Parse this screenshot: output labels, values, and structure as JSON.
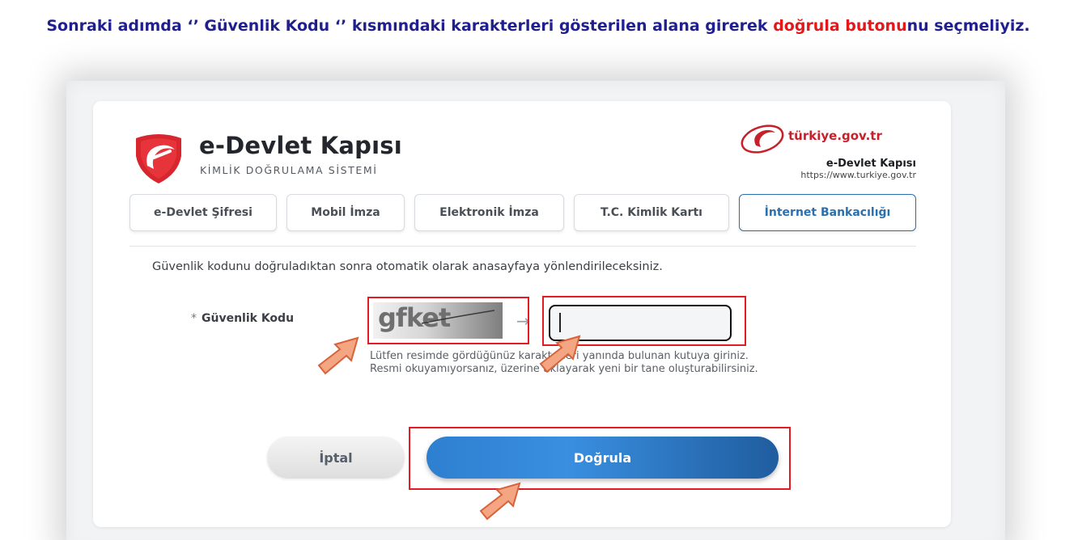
{
  "instruction": {
    "part1": "Sonraki adımda ‘’ Güvenlik Kodu ‘’ kısmındaki karakterleri gösterilen alana girerek ",
    "highlight": "doğrula butonu",
    "part2": "nu seçmeliyiz."
  },
  "header": {
    "brand_title": "e-Devlet Kapısı",
    "brand_subtitle": "KİMLİK DOĞRULAMA SİSTEMİ",
    "portal_logo_text": "türkiye.gov.tr",
    "portal_caption": "e-Devlet Kapısı",
    "portal_url": "https://www.turkiye.gov.tr"
  },
  "tabs": [
    {
      "label": "e-Devlet Şifresi",
      "active": false
    },
    {
      "label": "Mobil İmza",
      "active": false
    },
    {
      "label": "Elektronik İmza",
      "active": false
    },
    {
      "label": "T.C. Kimlik Kartı",
      "active": false
    },
    {
      "label": "İnternet Bankacılığı",
      "active": true
    }
  ],
  "form": {
    "info": "Güvenlik kodunu doğruladıktan sonra otomatik olarak anasayfaya yönlendirileceksiniz.",
    "required_mark": "*",
    "label": "Güvenlik Kodu",
    "captcha_text": "gfket",
    "input_value": "",
    "hint_line1": "Lütfen resimde gördüğünüz karakterleri yanında bulunan kutuya giriniz.",
    "hint_line2": "Resmi okuyamıyorsanız, üzerine tıklayarak yeni bir tane oluşturabilirsiniz."
  },
  "buttons": {
    "cancel": "İptal",
    "verify": "Doğrula"
  },
  "colors": {
    "instruction_text": "#1f1f8f",
    "highlight": "#e3181b",
    "annotation_box": "#e31b23",
    "annotation_arrow": "#f4a582",
    "primary_button": "#2e7fd0",
    "active_tab": "#2a6fae"
  }
}
